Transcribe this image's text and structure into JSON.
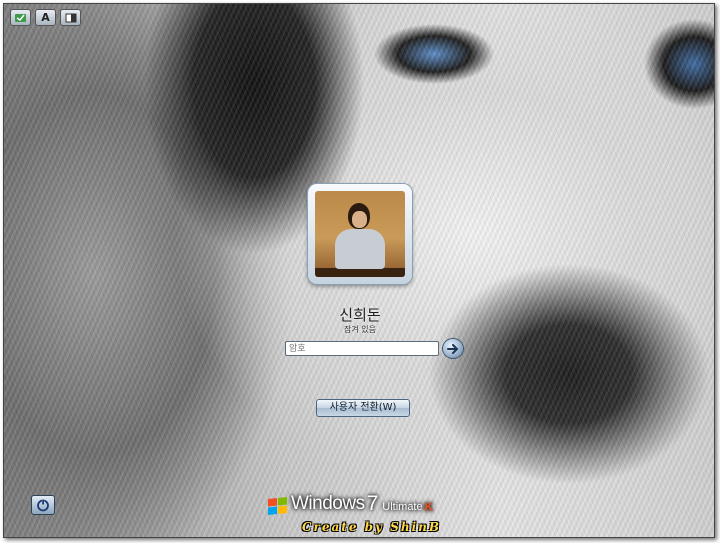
{
  "toolbar": {
    "ease_of_access_icon": "ease-of-access-icon",
    "font_icon_label": "A",
    "contrast_icon": "contrast-icon"
  },
  "login": {
    "username": "신희돈",
    "status": "잠겨 있음",
    "password_placeholder": "암호",
    "submit_icon": "arrow-right-icon",
    "switch_user_label": "사용자 전환(W)"
  },
  "footer": {
    "power_icon": "power-icon",
    "brand_name": "Windows",
    "brand_version": "7",
    "brand_edition": "Ultimate",
    "brand_locale": "K",
    "credit": "Create by ShinB"
  },
  "colors": {
    "accent": "#5d7a98",
    "credit_text": "#ffd94a",
    "locale_mark": "#e85020"
  }
}
